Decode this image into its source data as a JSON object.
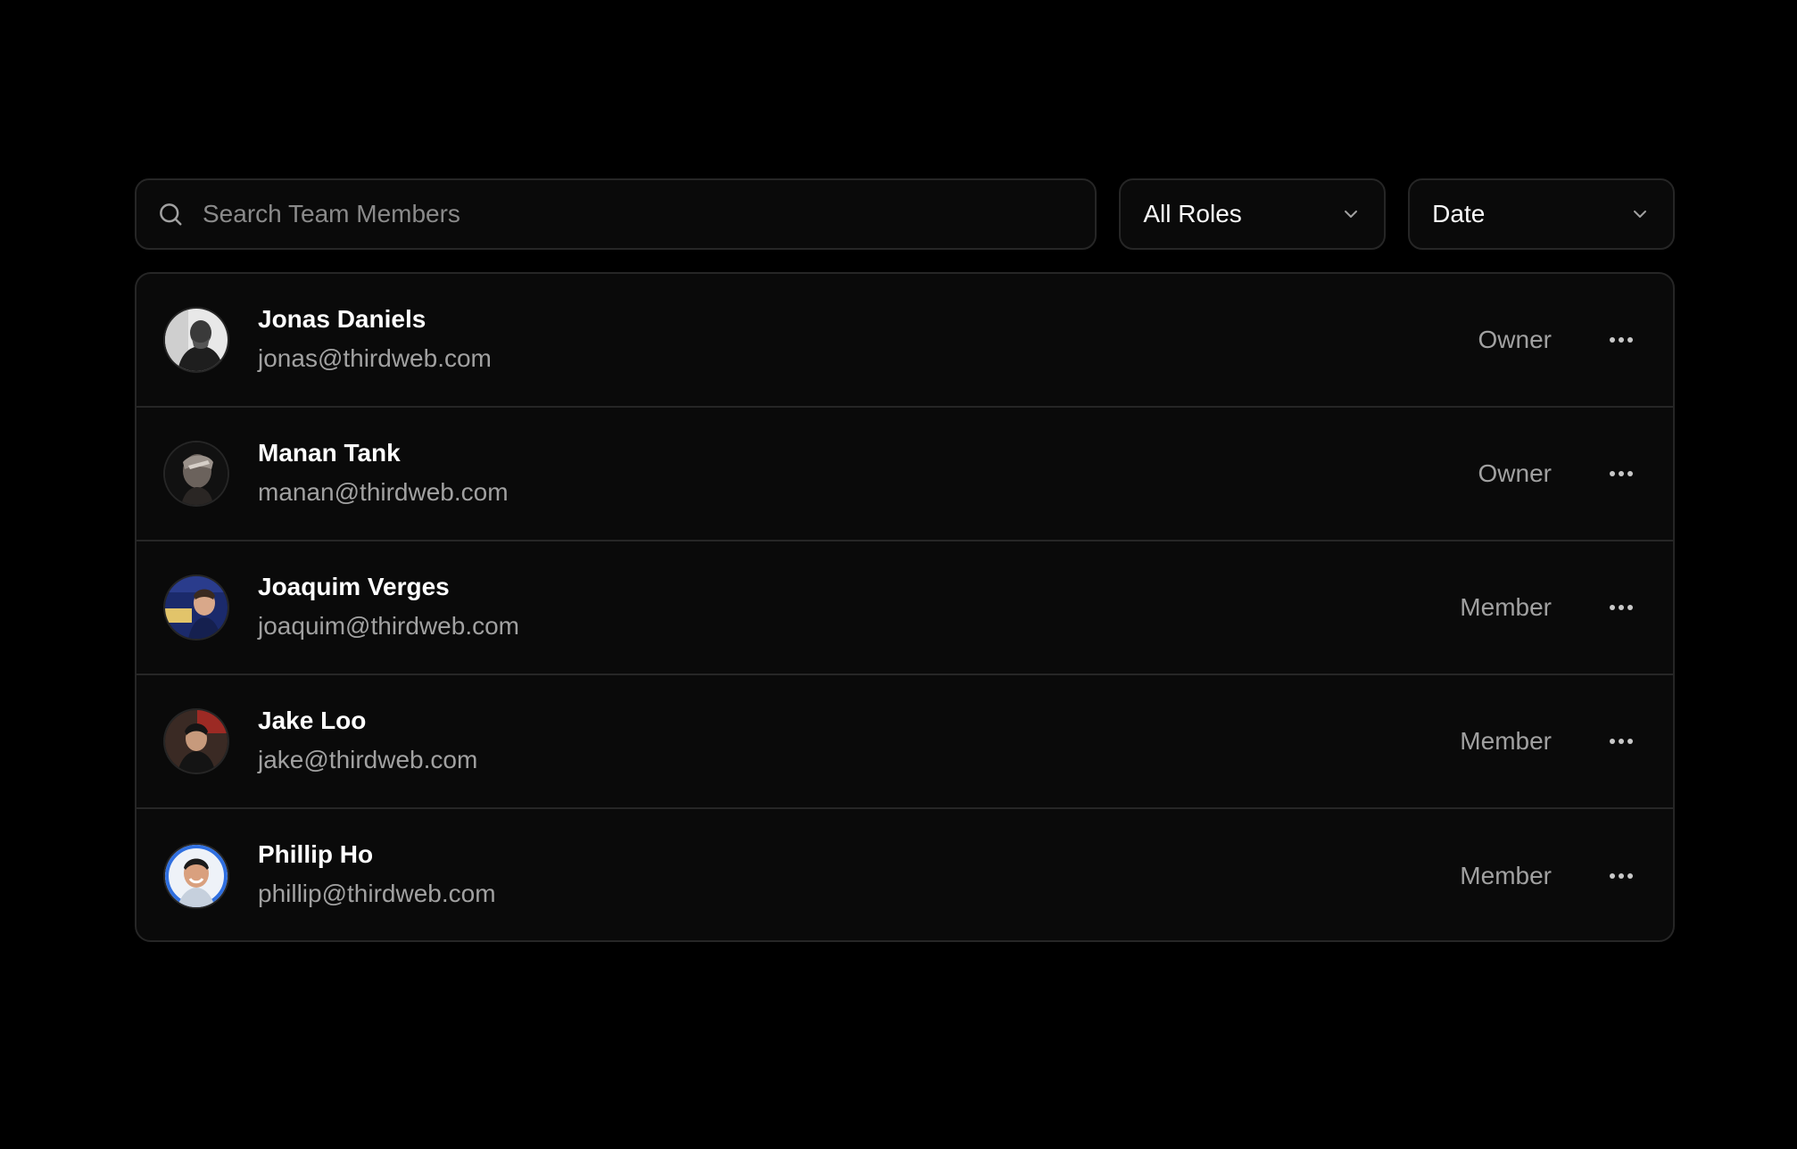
{
  "search": {
    "placeholder": "Search Team Members",
    "icon": "search-icon"
  },
  "filters": {
    "role": {
      "selected": "All Roles",
      "icon": "chevron-down-icon"
    },
    "sort": {
      "selected": "Date",
      "icon": "chevron-down-icon"
    }
  },
  "members": [
    {
      "name": "Jonas Daniels",
      "email": "jonas@thirdweb.com",
      "role": "Owner",
      "avatar_icon": "avatar",
      "menu_icon": "more-horizontal-icon"
    },
    {
      "name": "Manan Tank",
      "email": "manan@thirdweb.com",
      "role": "Owner",
      "avatar_icon": "avatar",
      "menu_icon": "more-horizontal-icon"
    },
    {
      "name": "Joaquim Verges",
      "email": "joaquim@thirdweb.com",
      "role": "Member",
      "avatar_icon": "avatar",
      "menu_icon": "more-horizontal-icon"
    },
    {
      "name": "Jake Loo",
      "email": "jake@thirdweb.com",
      "role": "Member",
      "avatar_icon": "avatar",
      "menu_icon": "more-horizontal-icon"
    },
    {
      "name": "Phillip Ho",
      "email": "phillip@thirdweb.com",
      "role": "Member",
      "avatar_icon": "avatar",
      "menu_icon": "more-horizontal-icon"
    }
  ],
  "colors": {
    "background": "#000000",
    "surface": "#0a0a0a",
    "border": "#262626",
    "text_primary": "#ffffff",
    "text_muted": "#a1a1a1"
  }
}
